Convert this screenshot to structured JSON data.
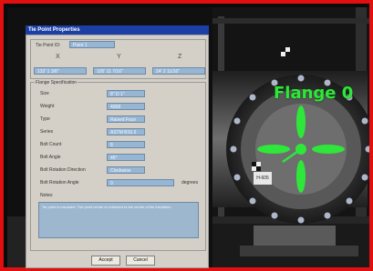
{
  "dialog": {
    "title": "Tie Point Properties",
    "tie_point_id_label": "Tie Point ID:",
    "tie_point_id_value": "Point 1",
    "coord_headers": [
      "X",
      "Y",
      "Z"
    ],
    "coord_values": [
      "132' 1 3/8\"",
      "105' 11 7/16\"",
      "24' 2 11/16\""
    ],
    "flange_spec_title": "Flange Specification",
    "size_label": "Size",
    "size_value": "8\" D 1\"",
    "weight_label": "Weight",
    "weight_value": "4068",
    "type_label": "Type",
    "type_value": "Raised Face",
    "series_label": "Series",
    "series_value": "ASTM B16.5",
    "bolt_count_label": "Bolt Count",
    "bolt_count_value": "8",
    "bolt_angle_label": "Bolt Angle",
    "bolt_angle_value": "45°",
    "bolt_rot_dir_label": "Bolt Rotation Direction",
    "bolt_rot_dir_value": "Clockwise",
    "bolt_rot_angle_label": "Bolt Rotation Angle",
    "bolt_rot_angle_value": "0",
    "degrees_label": "degrees",
    "notes_label": "Notes:",
    "notes_text": "Tie point is insulated. The point center is extracted to the center of the insulation.",
    "accept_label": "Accept",
    "cancel_label": "Cancel"
  },
  "viewer": {
    "flange_label": "Flange 0",
    "tag_text": "H-605",
    "overlay_color": "#2fe63a"
  },
  "colors": {
    "frame_border": "#e01010",
    "field_bg": "#97b6d4",
    "title_bar": "#1c3fa6"
  }
}
